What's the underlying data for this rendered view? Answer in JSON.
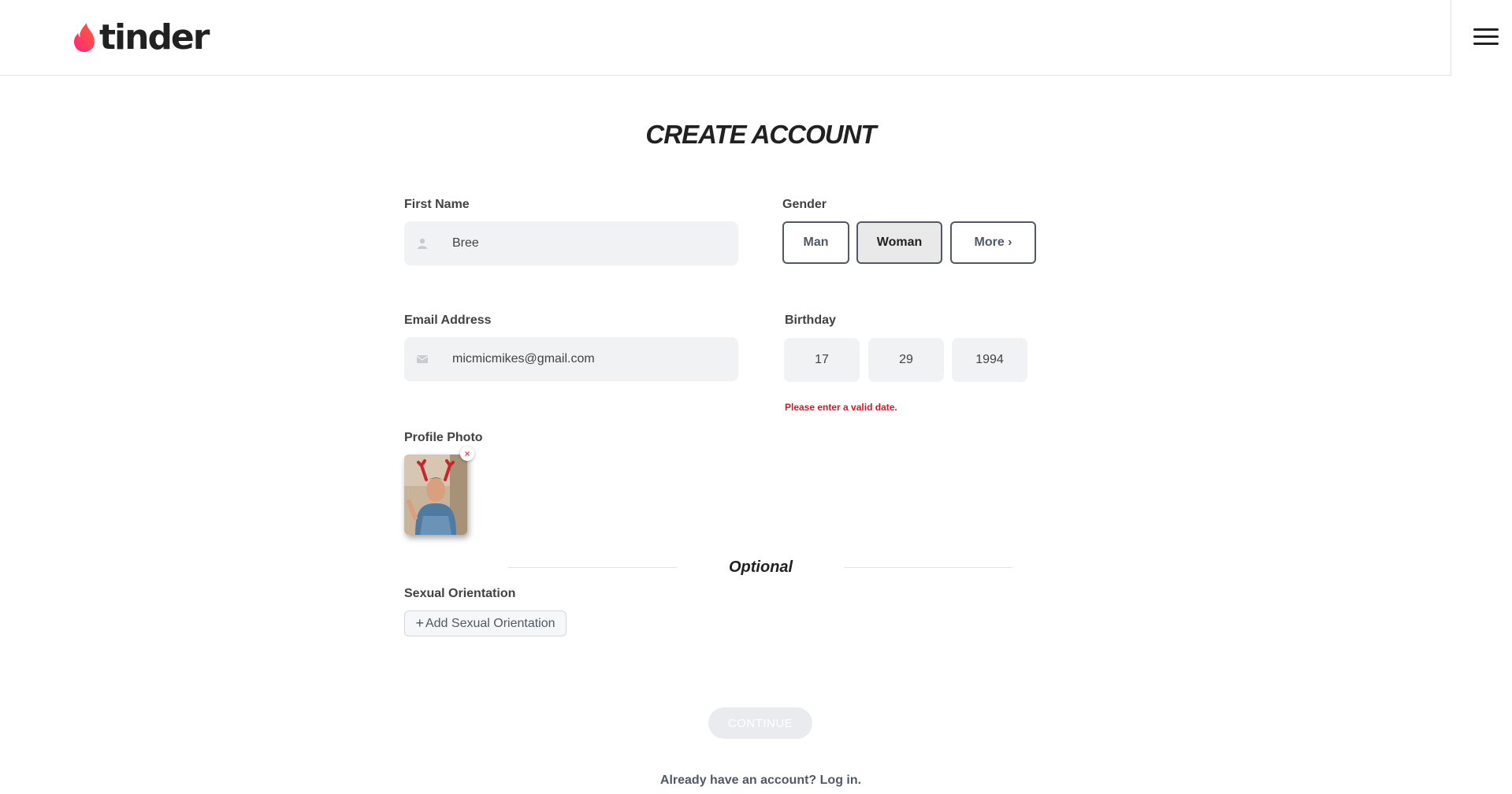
{
  "header": {
    "logo_text": "tinder",
    "brand_color": "#fd5068",
    "menu_icon": "hamburger-menu-icon"
  },
  "form": {
    "title": "CREATE ACCOUNT",
    "first_name": {
      "label": "First Name",
      "value": "Bree",
      "icon": "user-icon"
    },
    "email": {
      "label": "Email Address",
      "value": "micmicmikes@gmail.com",
      "icon": "envelope-icon"
    },
    "gender": {
      "label": "Gender",
      "options": [
        {
          "label": "Man",
          "selected": false
        },
        {
          "label": "Woman",
          "selected": true
        },
        {
          "label": "More ›",
          "selected": false
        }
      ]
    },
    "birthday": {
      "label": "Birthday",
      "month": "17",
      "day": "29",
      "year": "1994",
      "error": "Please enter a valid date."
    },
    "profile_photo": {
      "label": "Profile Photo",
      "remove_label": "×"
    },
    "optional_label": "Optional",
    "sexual_orientation": {
      "label": "Sexual Orientation",
      "add_label": "Add Sexual Orientation",
      "add_prefix": "+"
    },
    "continue_label": "CONTINUE",
    "login_text": "Already have an account? Log in."
  },
  "colors": {
    "error": "#e4111d",
    "continue_disabled_bg": "#e9ebee"
  }
}
